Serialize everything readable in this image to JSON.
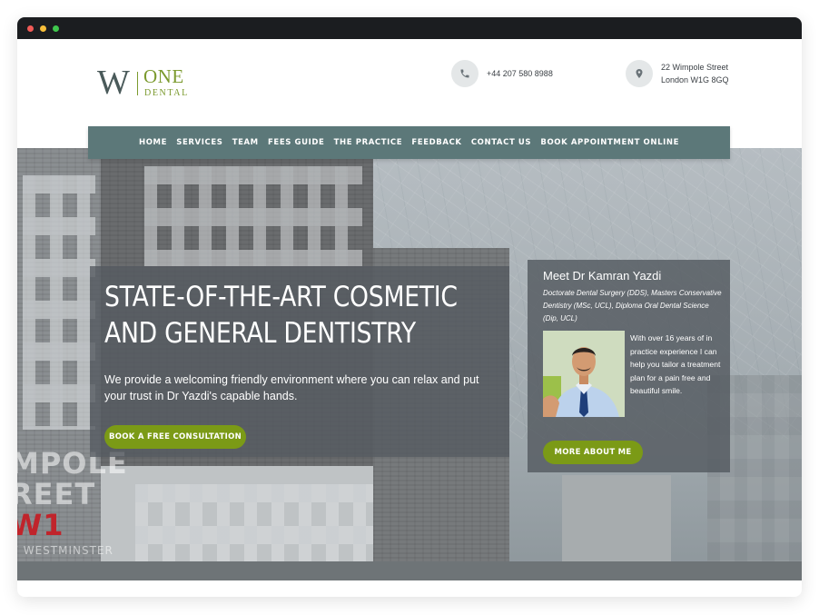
{
  "logo": {
    "mark": "W",
    "name": "ONE",
    "sub": "DENTAL"
  },
  "contact": {
    "phone": "+44 207 580 8988",
    "address_line1": "22 Wimpole Street",
    "address_line2": "London W1G 8GQ"
  },
  "nav": {
    "items": [
      "HOME",
      "SERVICES",
      "TEAM",
      "FEES GUIDE",
      "THE PRACTICE",
      "FEEDBACK",
      "CONTACT US",
      "BOOK APPOINTMENT ONLINE"
    ]
  },
  "hero": {
    "title_line1": "STATE-OF-THE-ART COSMETIC",
    "title_line2": "AND GENERAL DENTISTRY",
    "text": "We provide a welcoming friendly environment where you can relax and put your trust in Dr Yazdi's capable hands.",
    "cta": "BOOK A FREE CONSULTATION"
  },
  "street_sign": {
    "line1": "MPOLE",
    "line2_a": "REET ",
    "line2_b": "W1",
    "line3": "F WESTMINSTER"
  },
  "doctor": {
    "heading": "Meet Dr Kamran Yazdi",
    "credentials": "Doctorate Dental Surgery (DDS), Masters Conservative Dentistry (MSc, UCL), Diploma Oral Dental Science (Dip, UCL)",
    "bio": "With over 16 years of in practice experience I can help you tailor a treatment plan for a pain free and beautiful smile.",
    "cta": "MORE ABOUT ME"
  },
  "colors": {
    "nav": "#5c7879",
    "accent_green": "#7b9a16",
    "logo_green": "#7b9a2e"
  }
}
